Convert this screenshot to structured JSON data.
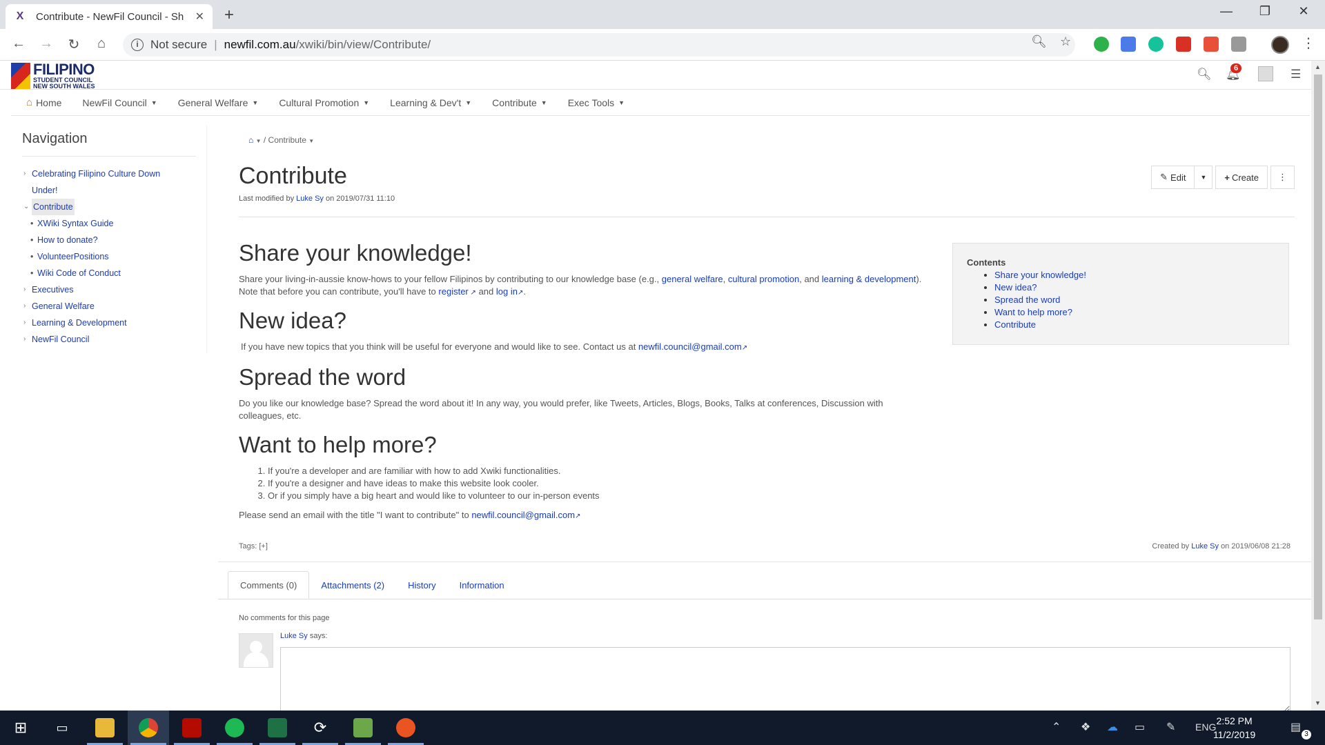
{
  "browser": {
    "tab_title": "Contribute - NewFil Council - Sh",
    "favicon": "X",
    "url_security": "Not secure",
    "url_domain": "newfil.com.au",
    "url_path": "/xwiki/bin/view/Contribute/"
  },
  "site": {
    "logo_line1": "FILIPINO",
    "logo_line2": "STUDENT COUNCIL",
    "logo_line3": "NEW SOUTH WALES",
    "notification_count": "6"
  },
  "menu": [
    {
      "label": "Home"
    },
    {
      "label": "NewFil Council"
    },
    {
      "label": "General Welfare"
    },
    {
      "label": "Cultural Promotion"
    },
    {
      "label": "Learning & Dev't"
    },
    {
      "label": "Contribute"
    },
    {
      "label": "Exec Tools"
    }
  ],
  "navigation": {
    "title": "Navigation",
    "items": [
      {
        "label": "Celebrating Filipino Culture Down Under!",
        "toggle": "›"
      },
      {
        "label": "Contribute",
        "toggle": "⌄"
      },
      {
        "label": "XWiki Syntax Guide"
      },
      {
        "label": "How to donate?"
      },
      {
        "label": "VolunteerPositions"
      },
      {
        "label": "Wiki Code of Conduct"
      },
      {
        "label": "Executives",
        "toggle": "›"
      },
      {
        "label": "General Welfare",
        "toggle": "›"
      },
      {
        "label": "Learning & Development",
        "toggle": "›"
      },
      {
        "label": "NewFil Council",
        "toggle": "›"
      }
    ]
  },
  "page": {
    "breadcrumb_current": "Contribute",
    "title": "Contribute",
    "meta_prefix": "Last modified by",
    "meta_author": "Luke Sy",
    "meta_suffix": "on 2019/07/31 11:10",
    "actions": {
      "edit": "Edit",
      "create": "Create"
    },
    "sections": {
      "share_title": "Share your knowledge!",
      "share_text_1": "Share your living-in-aussie know-hows to your fellow Filipinos by contributing to our knowledge base (e.g.,",
      "share_link_1": "general welfare",
      "share_link_2": "cultural promotion",
      "share_text_2": ", and",
      "share_link_3": "learning & development",
      "share_text_3": "). Note that before you can contribute, you'll have to",
      "share_link_4": "register",
      "share_text_4": "and",
      "share_link_5": "log in",
      "idea_title": "New idea?",
      "idea_text": "If you have new topics that you think will be useful for everyone and would like to see. Contact us at",
      "email": "newfil.council@gmail.com",
      "spread_title": "Spread the word",
      "spread_text": "Do you like our knowledge base? Spread the word about it! In any way, you would prefer, like Tweets, Articles, Blogs, Books, Talks at conferences, Discussion with colleagues, etc.",
      "help_title": "Want to help more?",
      "help_items": [
        "If you're a developer and are familiar with how to add Xwiki functionalities.",
        "If you're a designer and have ideas to make this website look cooler.",
        "Or if you simply have a big heart and would like to volunteer to our in-person events"
      ],
      "help_send": "Please send an email with the title \"I want to contribute\" to"
    },
    "toc": {
      "title": "Contents",
      "items": [
        "Share your knowledge!",
        "New idea?",
        "Spread the word",
        "Want to help more?",
        "Contribute"
      ]
    },
    "tags_label": "Tags:",
    "tags_add": "[+]",
    "created_prefix": "Created by",
    "created_author": "Luke Sy",
    "created_suffix": "on 2019/06/08 21:28",
    "tabs": [
      "Comments (0)",
      "Attachments (2)",
      "History",
      "Information"
    ],
    "no_comments": "No comments for this page",
    "comment_author": "Luke Sy",
    "comment_says": "says:"
  },
  "taskbar": {
    "time": "2:52 PM",
    "date": "11/2/2019",
    "language": "ENG",
    "notifications": "3"
  },
  "colors": {
    "link": "#1a3cb8",
    "taskbar": "#101a2b",
    "badge": "#d9241b"
  }
}
